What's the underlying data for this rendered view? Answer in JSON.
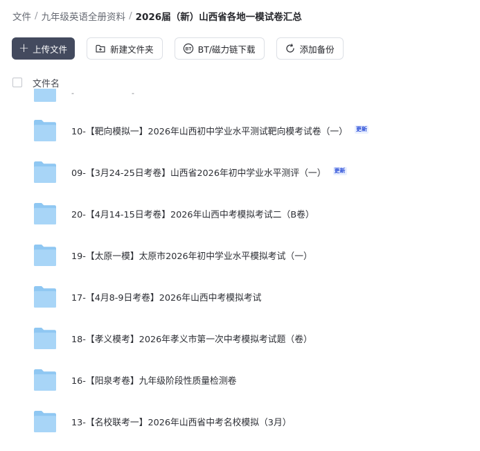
{
  "breadcrumb": {
    "items": [
      "文件",
      "九年级英语全册资料"
    ],
    "current": "2026届（新）山西省各地一模试卷汇总",
    "separator": "/"
  },
  "toolbar": {
    "upload_label": "上传文件",
    "new_folder_label": "新建文件夹",
    "bt_label": "BT/磁力链下载",
    "backup_label": "添加备份",
    "bt_icon_text": "BT"
  },
  "list_header": {
    "column_label": "文件名"
  },
  "partial_row": {
    "text_left": "-",
    "text_right": "-"
  },
  "files": [
    {
      "name": "10-【靶向模拟一】2026年山西初中学业水平测试靶向模考试卷（一）",
      "tag": "更新"
    },
    {
      "name": "09-【3月24-25日考卷】山西省2026年初中学业水平测评（一）",
      "tag": "更新"
    },
    {
      "name": "20-【4月14-15日考卷】2026年山西中考模拟考试二（B卷）",
      "tag": ""
    },
    {
      "name": "19-【太原一模】太原市2026年初中学业水平模拟考试（一）",
      "tag": ""
    },
    {
      "name": "17-【4月8-9日考卷】2026年山西中考模拟考试",
      "tag": ""
    },
    {
      "name": "18-【孝义模考】2026年孝义市第一次中考模拟考试题（卷）",
      "tag": ""
    },
    {
      "name": "16-【阳泉考卷】九年级阶段性质量检测卷",
      "tag": ""
    },
    {
      "name": "13-【名校联考一】2026年山西省中考名校模拟（3月）",
      "tag": ""
    }
  ],
  "colors": {
    "primary_button": "#434a5e",
    "tag_text": "#2c4fd8",
    "tag_bg": "#eaf0ff",
    "folder": "#8fc7f2"
  },
  "icons": [
    "plus-icon",
    "new-folder-icon",
    "bt-icon",
    "refresh-icon",
    "folder-icon"
  ]
}
